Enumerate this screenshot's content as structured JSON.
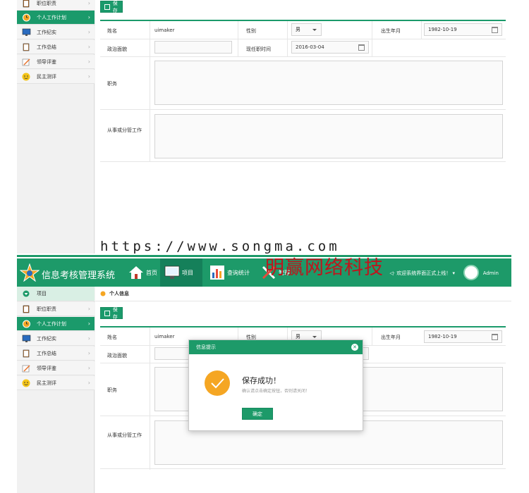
{
  "header": {
    "app_title": "信息考核管理系统",
    "nav": [
      {
        "label": "首页"
      },
      {
        "label": "项目"
      },
      {
        "label": "查询统计"
      },
      {
        "label": "管理"
      }
    ],
    "notice": "欢迎系统界面正式上线！",
    "user": "Admin"
  },
  "sidebar": {
    "section_title": "项目",
    "items": [
      {
        "label": "职位职责"
      },
      {
        "label": "个人工作计划"
      },
      {
        "label": "工作纪实"
      },
      {
        "label": "工作总结"
      },
      {
        "label": "领导评鉴"
      },
      {
        "label": "民主测评"
      }
    ]
  },
  "breadcrumb": "个人信息",
  "toolbar": {
    "save_label": "保存"
  },
  "form": {
    "name_label": "姓名",
    "name_value": "uimaker",
    "gender_label": "性别",
    "gender_value": "男",
    "birth_label": "出生年月",
    "birth_value": "1982-10-19",
    "politics_label": "政治面貌",
    "politics_value": "",
    "since_label": "现任职时间",
    "since_value": "2016-03-04",
    "duty_label": "职务",
    "work_label": "从事或分管工作"
  },
  "overlay": {
    "url": "https://www.songma.com",
    "watermark": "明赢网络科技"
  },
  "dialog": {
    "title": "信息提示",
    "heading": "保存成功！",
    "message": "确认请点击确定按钮，否则请关闭！",
    "ok_label": "确定"
  }
}
